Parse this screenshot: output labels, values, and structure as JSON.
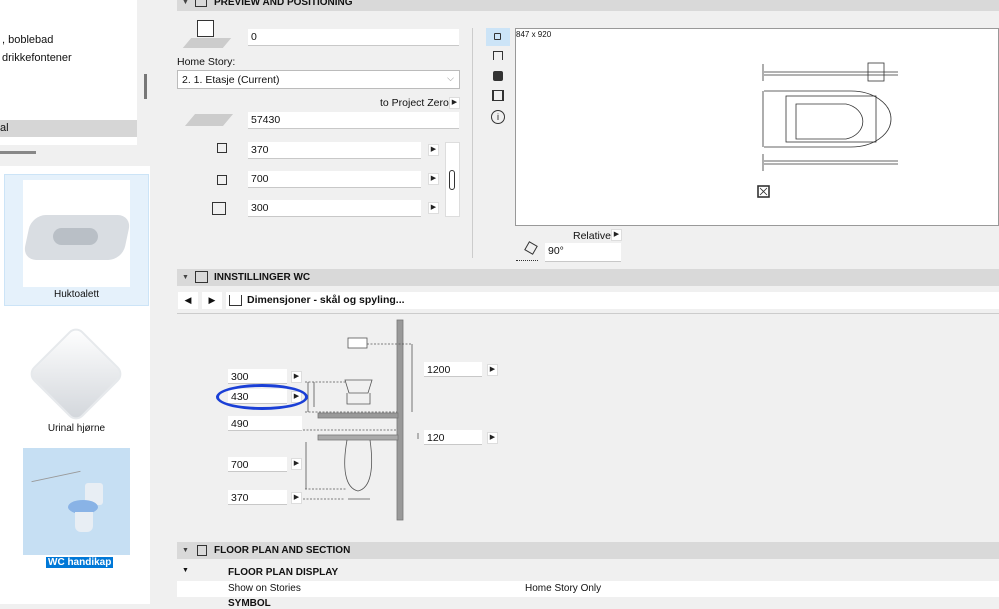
{
  "library": {
    "list_items": [
      ", boblebad",
      "drikkefontener"
    ],
    "selected_item": "al",
    "thumbnails": [
      {
        "label": "Huktoalett",
        "state": "hover"
      },
      {
        "label": "Urinal hjørne",
        "state": "normal"
      },
      {
        "label": "WC handikap",
        "state": "selected"
      }
    ]
  },
  "preview_positioning": {
    "title": "PREVIEW AND POSITIONING",
    "elevation": "0",
    "home_story_label": "Home Story:",
    "home_story": "2. 1. Etasje (Current)",
    "to_project_zero": "to Project Zero",
    "project_zero_value": "57430",
    "width": "370",
    "depth": "700",
    "height": "300",
    "preview_size": "847 x 920",
    "relative": "Relative",
    "angle": "90°"
  },
  "innstillinger": {
    "title": "INNSTILLINGER WC",
    "page": "Dimensjoner - skål og spyling...",
    "fields": {
      "a": "300",
      "b": "430",
      "c": "490",
      "d": "700",
      "e": "370",
      "f": "1200",
      "g": "120"
    },
    "highlight_color": "#1a3fd6"
  },
  "floor_plan": {
    "title": "FLOOR PLAN AND SECTION",
    "subsection": "FLOOR PLAN DISPLAY",
    "row_label": "Show on Stories",
    "row_value": "Home Story Only",
    "next": "SYMBOL"
  }
}
